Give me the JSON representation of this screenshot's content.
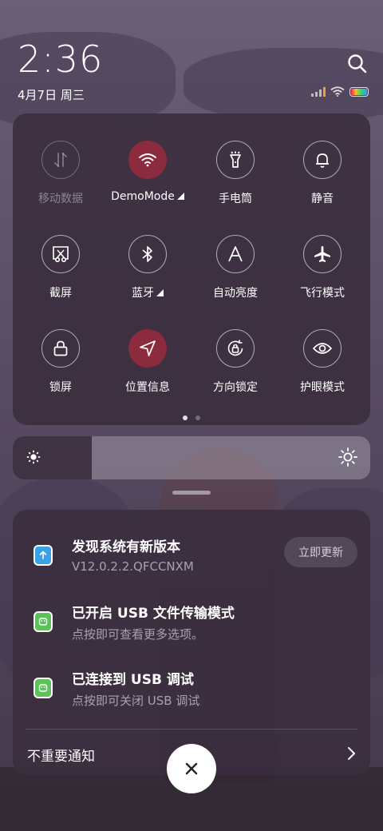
{
  "status": {
    "time": "2:36",
    "date": "4月7日 周三"
  },
  "quick_settings": {
    "tiles": [
      {
        "label": "移动数据",
        "icon": "mobile-data-icon",
        "state": "disabled"
      },
      {
        "label": "DemoMode",
        "icon": "wifi-icon",
        "state": "active",
        "expandable": true
      },
      {
        "label": "手电筒",
        "icon": "flashlight-icon",
        "state": "off"
      },
      {
        "label": "静音",
        "icon": "bell-icon",
        "state": "off"
      },
      {
        "label": "截屏",
        "icon": "screenshot-icon",
        "state": "off"
      },
      {
        "label": "蓝牙",
        "icon": "bluetooth-icon",
        "state": "off",
        "expandable": true
      },
      {
        "label": "自动亮度",
        "icon": "auto-brightness-icon",
        "state": "off"
      },
      {
        "label": "飞行模式",
        "icon": "airplane-icon",
        "state": "off"
      },
      {
        "label": "锁屏",
        "icon": "lock-icon",
        "state": "off"
      },
      {
        "label": "位置信息",
        "icon": "location-icon",
        "state": "active"
      },
      {
        "label": "方向锁定",
        "icon": "rotation-lock-icon",
        "state": "off"
      },
      {
        "label": "护眼模式",
        "icon": "eye-icon",
        "state": "off"
      }
    ],
    "page_index": 1,
    "page_count": 2
  },
  "brightness": {
    "level": 0.22
  },
  "notifications": [
    {
      "title": "发现系统有新版本",
      "subtitle": "V12.0.2.2.QFCCNXM",
      "action": "立即更新",
      "icon": "system-update-icon",
      "icon_color": "#3aa0e8"
    },
    {
      "title": "已开启 USB 文件传输模式",
      "subtitle": "点按即可查看更多选项。",
      "icon": "android-icon",
      "icon_color": "#5cc25a"
    },
    {
      "title": "已连接到 USB 调试",
      "subtitle": "点按即可关闭 USB 调试",
      "icon": "android-icon",
      "icon_color": "#5cc25a"
    }
  ],
  "footer": {
    "unimportant_label": "不重要通知"
  },
  "colors": {
    "panel": "#3a2e3e",
    "active_tile": "#8b2b3d"
  }
}
